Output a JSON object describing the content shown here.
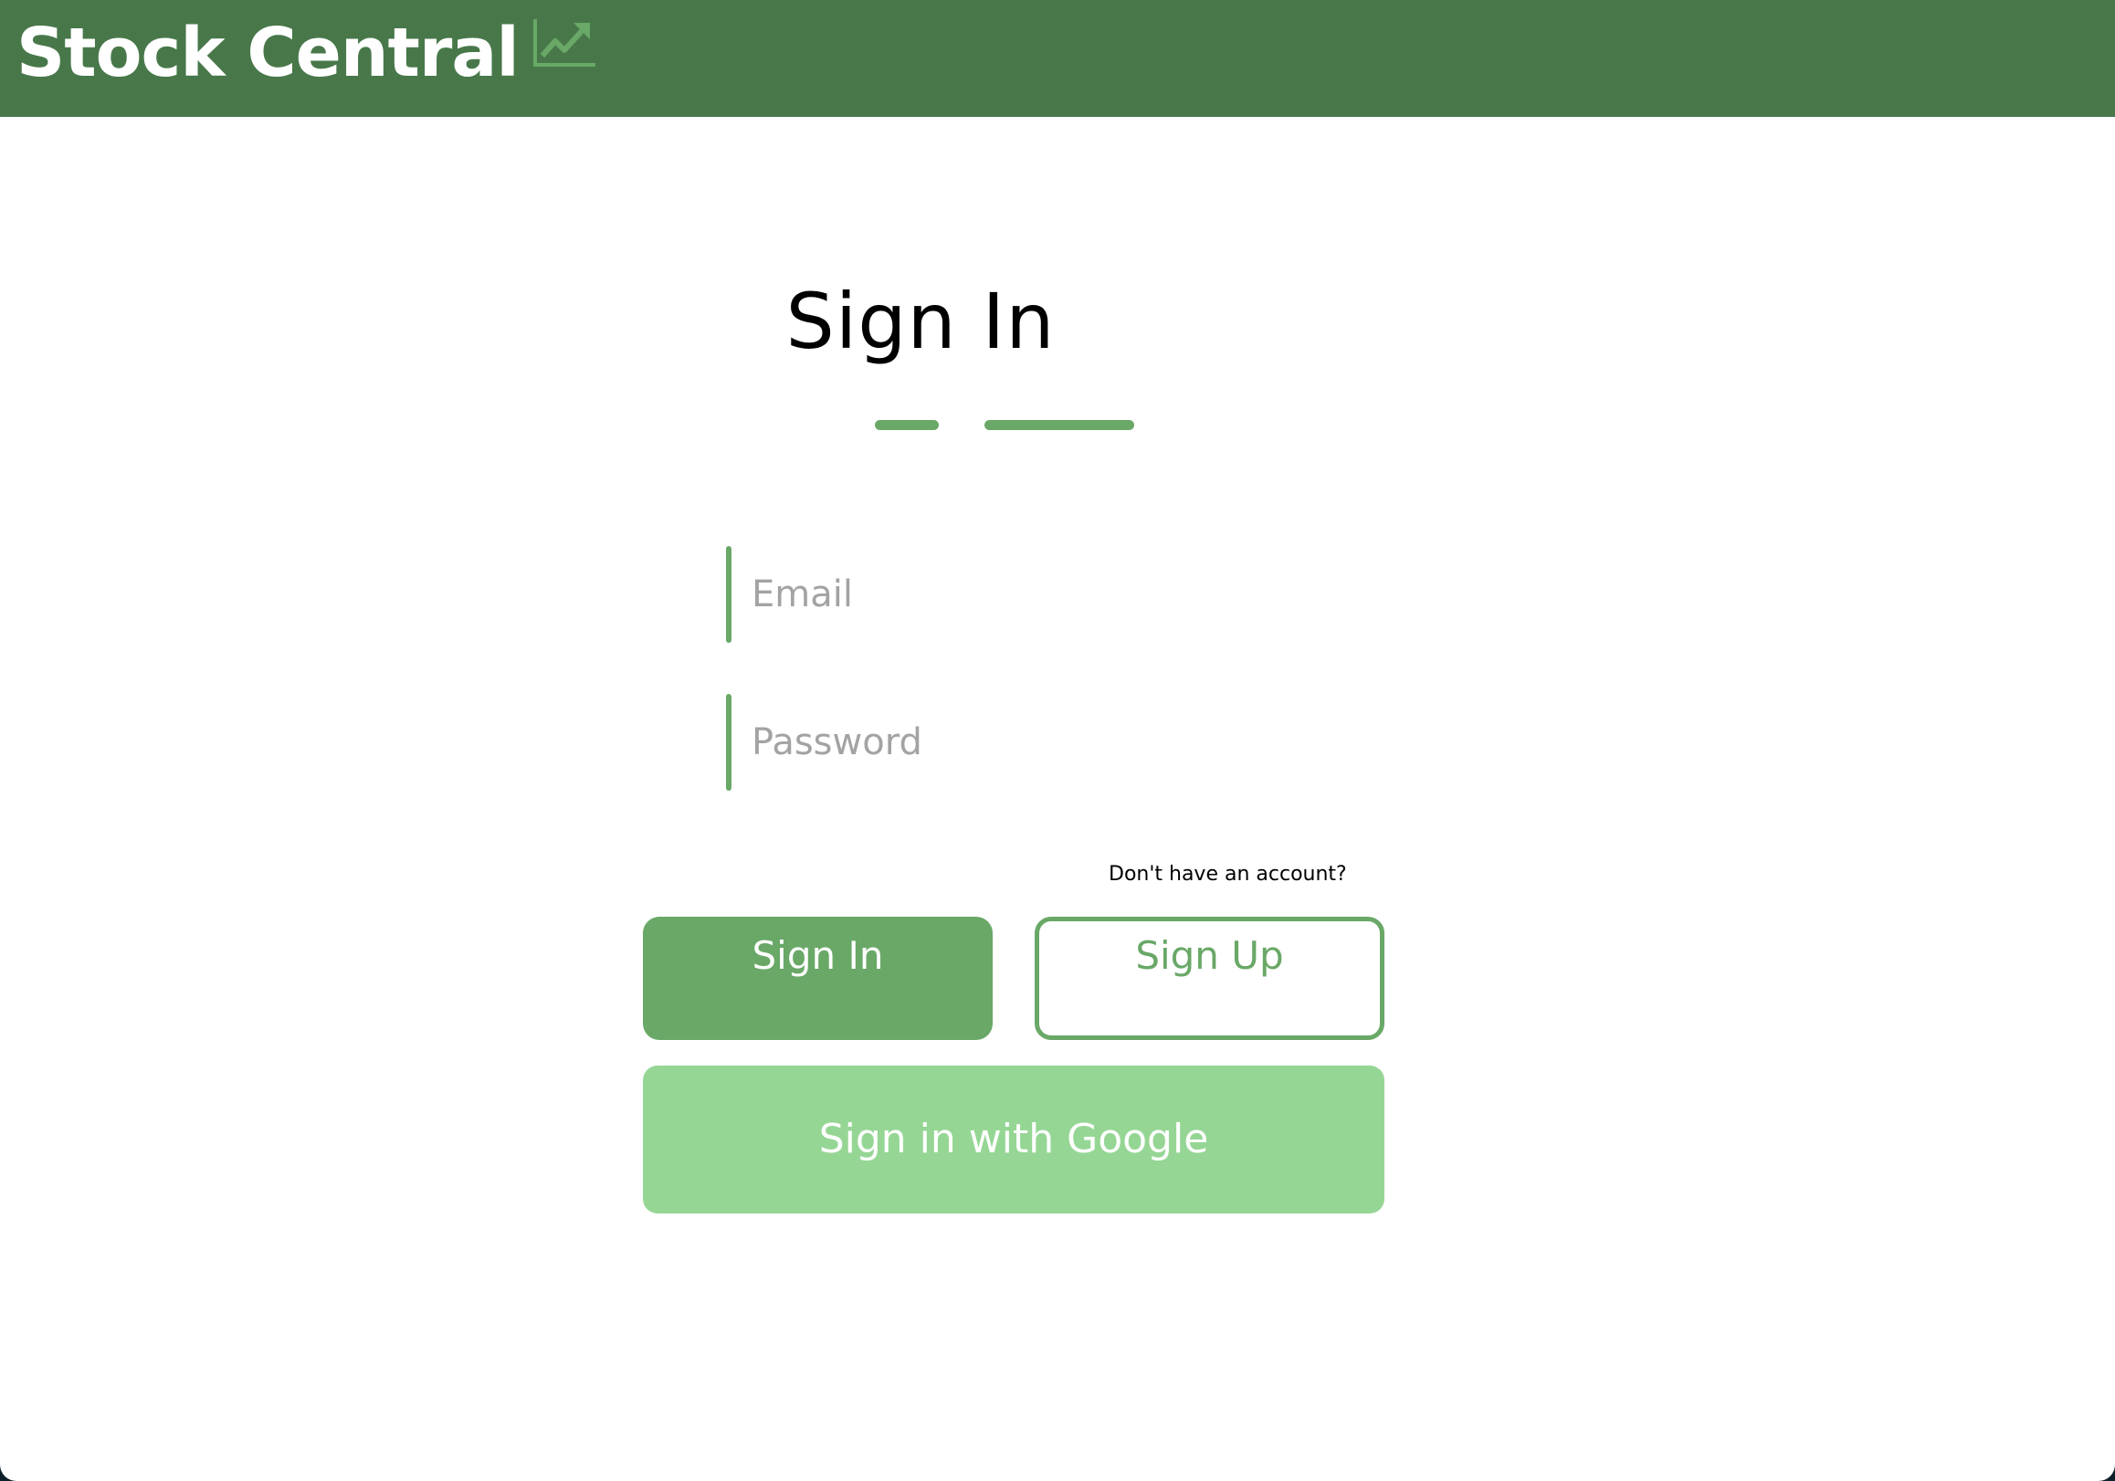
{
  "header": {
    "brand_title": "Stock Central",
    "brand_icon": "trending-up-chart-icon",
    "background_color": "#48784a",
    "accent_color": "#69a867"
  },
  "main": {
    "heading": "Sign In",
    "email_placeholder": "Email",
    "email_value": "",
    "password_placeholder": "Password",
    "password_value": "",
    "account_prompt": "Don't have an account?",
    "signin_label": "Sign In",
    "signup_label": "Sign Up",
    "google_label": "Sign in with Google",
    "google_color": "#96d695"
  }
}
